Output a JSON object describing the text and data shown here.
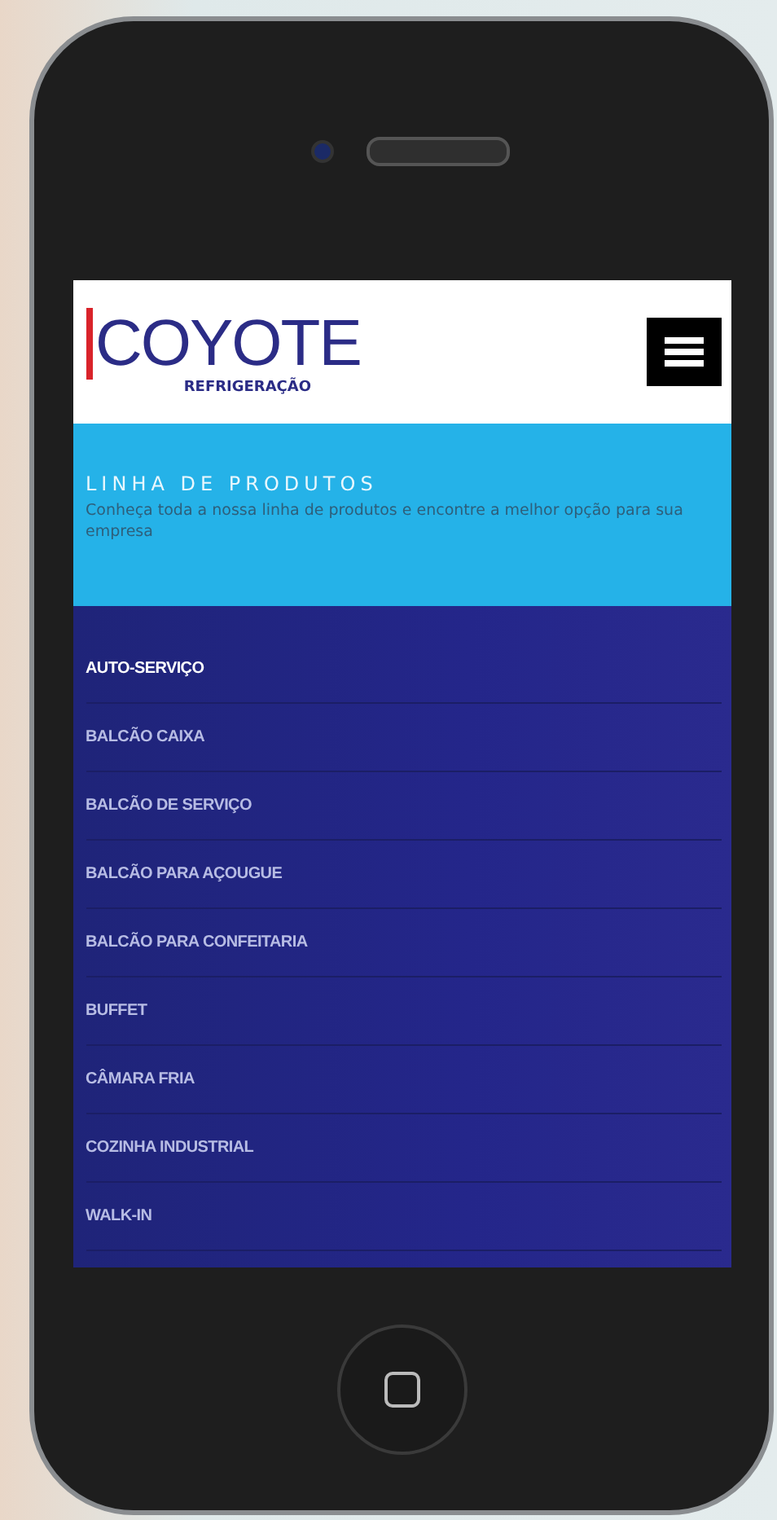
{
  "header": {
    "logo": "COYOTE",
    "logo_subtitle": "REFRIGERAÇÃO"
  },
  "banner": {
    "title": "LINHA DE PRODUTOS",
    "text": "Conheça toda a nossa linha de produtos e encontre a melhor opção para sua empresa"
  },
  "menu": [
    {
      "label": "AUTO-SERVIÇO",
      "selected": true
    },
    {
      "label": "BALCÃO CAIXA",
      "selected": false
    },
    {
      "label": "BALCÃO DE SERVIÇO",
      "selected": false
    },
    {
      "label": "BALCÃO PARA AÇOUGUE",
      "selected": false
    },
    {
      "label": "BALCÃO PARA CONFEITARIA",
      "selected": false
    },
    {
      "label": "BUFFET",
      "selected": false
    },
    {
      "label": "CÂMARA FRIA",
      "selected": false
    },
    {
      "label": "COZINHA INDUSTRIAL",
      "selected": false
    },
    {
      "label": "WALK-IN",
      "selected": false
    }
  ]
}
